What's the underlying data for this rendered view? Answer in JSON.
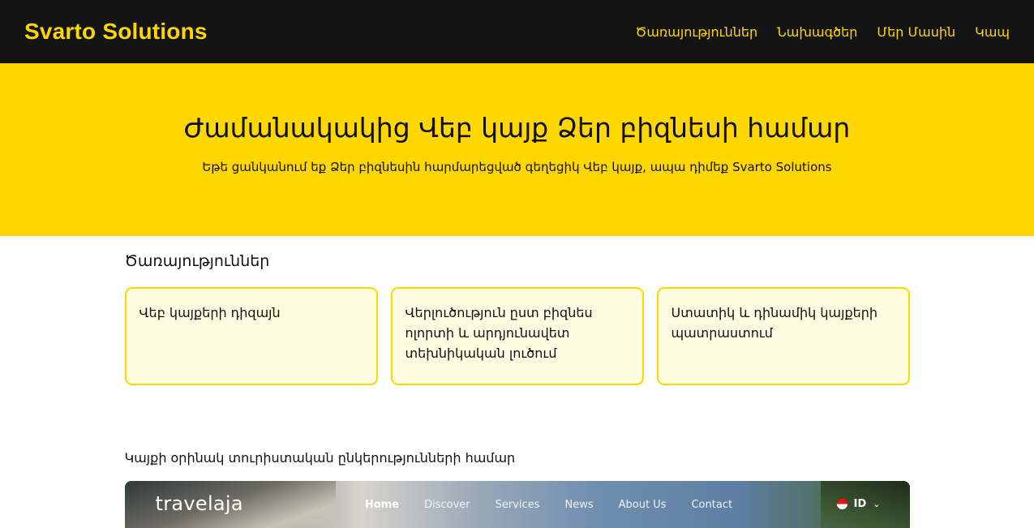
{
  "header": {
    "brand": "Svarto Solutions",
    "nav": [
      "Ծառայություններ",
      "Նախագծեր",
      "Մեր Մասին",
      "Կապ"
    ]
  },
  "hero": {
    "title": "Ժամանակակից Վեբ կայք Ձեր բիզնեսի համար",
    "subtitle": "Եթե ցանկանում եք Ձեր բիզնեսին հարմարեցված գեղեցիկ Վեբ կայք, ապա դիմեք Svarto Solutions"
  },
  "services": {
    "title": "Ծառայություններ",
    "cards": [
      "Վեբ կայքերի դիզայն",
      "Վերլուծություն ըստ բիզնես ոլորտի և արդյունավետ տեխնիկական լուծում",
      "Ստատիկ և դինամիկ կայքերի պատրաստում"
    ]
  },
  "example": {
    "title": "Կայքի օրինակ տուրիստական ընկերությունների համար",
    "preview": {
      "logo": "travelaja",
      "nav": [
        "Home",
        "Discover",
        "Services",
        "News",
        "About Us",
        "Contact"
      ],
      "lang": "ID"
    }
  },
  "colors": {
    "accent": "#ffd700",
    "header_bg": "#141414",
    "card_bg": "#fffbe0"
  }
}
